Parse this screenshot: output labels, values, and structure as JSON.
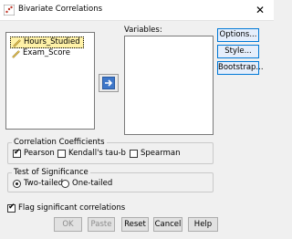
{
  "window": {
    "title": "Bivariate Correlations",
    "close_symbol": "✕"
  },
  "source_list": {
    "items": [
      "Hours_Studied",
      "Exam_Score"
    ]
  },
  "variables": {
    "label": "Variables:"
  },
  "side_buttons": [
    "Options...",
    "Style...",
    "Bootstrap..."
  ],
  "correlation_coefficients": {
    "legend": "Correlation Coefficients",
    "options": [
      {
        "label": "Pearson",
        "checked": true
      },
      {
        "label": "Kendall's tau-b",
        "checked": false
      },
      {
        "label": "Spearman",
        "checked": false
      }
    ]
  },
  "test_of_significance": {
    "legend": "Test of Significance",
    "options": [
      {
        "label": "Two-tailed",
        "selected": true
      },
      {
        "label": "One-tailed",
        "selected": false
      }
    ]
  },
  "flag": {
    "label": "Flag significant correlations",
    "checked": true
  },
  "bottom_buttons": [
    {
      "label": "OK",
      "enabled": false
    },
    {
      "label": "Paste",
      "enabled": false
    },
    {
      "label": "Reset",
      "enabled": true
    },
    {
      "label": "Cancel",
      "enabled": true
    },
    {
      "label": "Help",
      "enabled": true
    }
  ],
  "colors": {
    "selection": "#fff2a8",
    "arrow_button": "#3e77c9",
    "focus_border": "#0078d7"
  }
}
